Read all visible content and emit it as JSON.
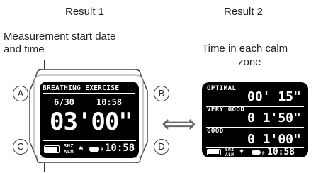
{
  "captions": {
    "result1": "Result 1",
    "result2": "Result 2",
    "measurement_line1": "Measurement start date",
    "measurement_line2": "and time",
    "calm_line1": "Time in each calm",
    "calm_line2": "zone"
  },
  "buttons": {
    "a": "A",
    "b": "B",
    "c": "C",
    "d": "D"
  },
  "watch1": {
    "title": "BREATHING EXERCISE",
    "date": "6/30",
    "time": "10:58",
    "duration": "03'00\"",
    "snz": "SNZ",
    "alm": "ALM",
    "pm": "P",
    "clock": "10:58"
  },
  "watch2": {
    "rows": [
      {
        "label": "OPTIMAL",
        "value": "00' 15\""
      },
      {
        "label": "VERY GOOD",
        "value": "0 1'50\""
      },
      {
        "label": "GOOD",
        "value": "0 1'00\""
      }
    ],
    "snz": "SNZ",
    "alm": "ALM",
    "pm": "P",
    "clock": "10:58"
  },
  "arrow": "⟺"
}
